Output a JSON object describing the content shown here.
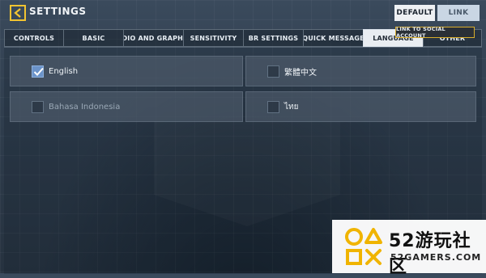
{
  "header": {
    "title": "SETTINGS",
    "default_label": "DEFAULT",
    "link_label": "LINK"
  },
  "tabs": [
    {
      "label": "CONTROLS",
      "active": false
    },
    {
      "label": "BASIC",
      "active": false
    },
    {
      "label": "AUDIO AND GRAPHICS",
      "active": false
    },
    {
      "label": "SENSITIVITY",
      "active": false
    },
    {
      "label": "BR SETTINGS",
      "active": false
    },
    {
      "label": "QUICK MESSAGE",
      "active": false
    },
    {
      "label": "LANGUAGE",
      "active": true
    },
    {
      "label": "OTHER",
      "active": false
    }
  ],
  "tooltip": "LINK TO SOCIAL ACCOUNT",
  "languages": [
    {
      "label": "English",
      "checked": true,
      "enabled": true
    },
    {
      "label": "繁體中文",
      "checked": false,
      "enabled": true
    },
    {
      "label": "Bahasa Indonesia",
      "checked": false,
      "enabled": false
    },
    {
      "label": "ไทย",
      "checked": false,
      "enabled": true
    }
  ],
  "watermark": {
    "brand": "52游玩社区",
    "site": "52GAMERS.COM"
  },
  "colors": {
    "accent": "#f2c431",
    "check": "#6b93c9"
  }
}
